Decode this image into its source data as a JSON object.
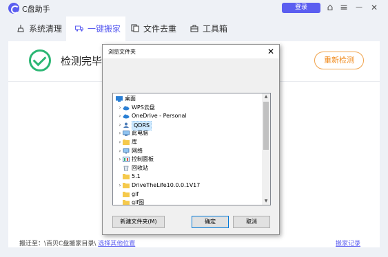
{
  "app": {
    "title": "C盘助手",
    "login_label": "登录",
    "window_controls": {
      "home": "⌂",
      "menu": "≡",
      "minimize": "—",
      "close": "✕"
    }
  },
  "tabs": [
    {
      "label": "系统清理",
      "icon": "system-clean-icon",
      "active": false
    },
    {
      "label": "一键搬家",
      "icon": "move-truck-icon",
      "active": true
    },
    {
      "label": "文件去重",
      "icon": "file-dedupe-icon",
      "active": false
    },
    {
      "label": "工具箱",
      "icon": "toolbox-icon",
      "active": false
    }
  ],
  "main": {
    "status_text": "检测完毕，",
    "recheck_label": "重新检测",
    "footer": {
      "move_to_label": "搬迁至：\\百贝C盘搬家目录\\",
      "choose_location_link": "选择其他位置",
      "history_link": "搬家记录"
    }
  },
  "dialog": {
    "title": "浏览文件夹",
    "close": "✕",
    "tree": [
      {
        "label": "桌面",
        "icon": "desktop-icon",
        "expandable": false,
        "level": 0,
        "selected": false
      },
      {
        "label": "WPS云盘",
        "icon": "cloud-icon",
        "expandable": true,
        "level": 1,
        "selected": false
      },
      {
        "label": "OneDrive - Personal",
        "icon": "cloud-icon",
        "expandable": true,
        "level": 1,
        "selected": false
      },
      {
        "label": "QDRS",
        "icon": "user-icon",
        "expandable": true,
        "level": 1,
        "selected": true
      },
      {
        "label": "此电脑",
        "icon": "computer-icon",
        "expandable": true,
        "level": 1,
        "selected": false
      },
      {
        "label": "库",
        "icon": "library-icon",
        "expandable": true,
        "level": 1,
        "selected": false
      },
      {
        "label": "网络",
        "icon": "network-icon",
        "expandable": true,
        "level": 1,
        "selected": false
      },
      {
        "label": "控制面板",
        "icon": "control-panel-icon",
        "expandable": true,
        "level": 1,
        "selected": false
      },
      {
        "label": "回收站",
        "icon": "recycle-bin-icon",
        "expandable": false,
        "level": 1,
        "selected": false
      },
      {
        "label": "5.1",
        "icon": "folder-icon",
        "expandable": false,
        "level": 1,
        "selected": false
      },
      {
        "label": "DriveTheLife10.0.0.1V17",
        "icon": "folder-icon",
        "expandable": true,
        "level": 1,
        "selected": false
      },
      {
        "label": "gif",
        "icon": "folder-icon",
        "expandable": false,
        "level": 1,
        "selected": false
      },
      {
        "label": "gif图",
        "icon": "folder-icon",
        "expandable": false,
        "level": 1,
        "selected": false
      }
    ],
    "new_folder_label": "新建文件夹(M)",
    "ok_label": "确定",
    "cancel_label": "取消"
  },
  "colors": {
    "accent": "#5b5ef0",
    "success": "#2bb673",
    "warning": "#f08a1c",
    "folder": "#f5c94c"
  }
}
